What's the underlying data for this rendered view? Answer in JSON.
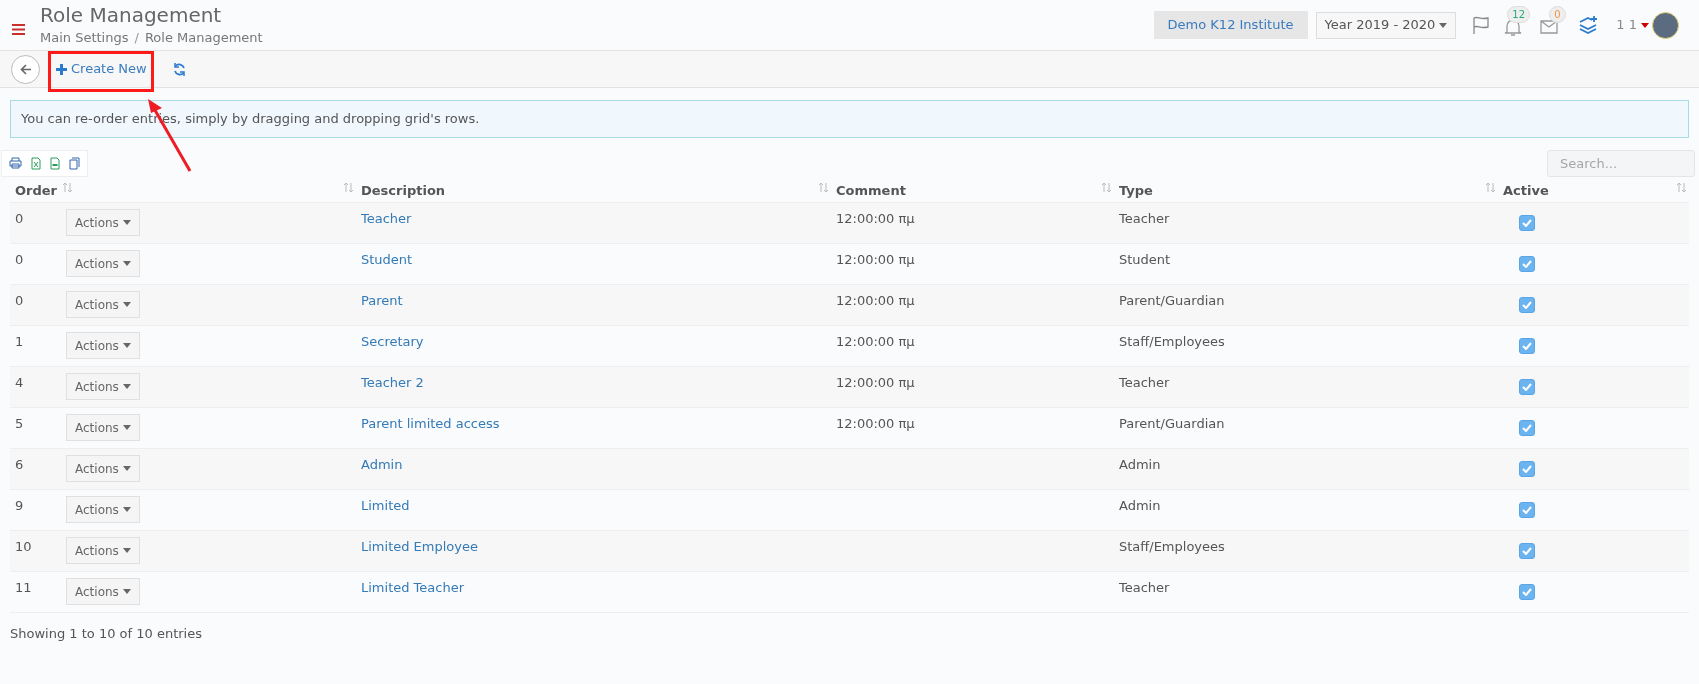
{
  "header": {
    "title": "Role Management",
    "breadcrumb": [
      "Main Settings",
      "Role Management"
    ],
    "separator": "/",
    "institute": "Demo K12 Institute",
    "year": "Year 2019 - 2020",
    "notifications": "12",
    "messages": "0",
    "user": "1 1"
  },
  "toolbar": {
    "create": "Create New"
  },
  "info": "You can re-order entries, simply by dragging and dropping grid's rows.",
  "search": {
    "placeholder": "Search..."
  },
  "table": {
    "columns": [
      "Order",
      "Description",
      "Comment",
      "Type",
      "Active"
    ],
    "rows": [
      {
        "order": "0",
        "action": "Actions",
        "description": "Teacher",
        "comment": "12:00:00 πμ",
        "type": "Teacher",
        "active": true
      },
      {
        "order": "0",
        "action": "Actions",
        "description": "Student",
        "comment": "12:00:00 πμ",
        "type": "Student",
        "active": true
      },
      {
        "order": "0",
        "action": "Actions",
        "description": "Parent",
        "comment": "12:00:00 πμ",
        "type": "Parent/Guardian",
        "active": true
      },
      {
        "order": "1",
        "action": "Actions",
        "description": "Secretary",
        "comment": "12:00:00 πμ",
        "type": "Staff/Employees",
        "active": true
      },
      {
        "order": "4",
        "action": "Actions",
        "description": "Teacher 2",
        "comment": "12:00:00 πμ",
        "type": "Teacher",
        "active": true
      },
      {
        "order": "5",
        "action": "Actions",
        "description": "Parent limited access",
        "comment": "12:00:00 πμ",
        "type": "Parent/Guardian",
        "active": true
      },
      {
        "order": "6",
        "action": "Actions",
        "description": "Admin",
        "type": "Admin",
        "active": true
      },
      {
        "order": "9",
        "action": "Actions",
        "description": "Limited",
        "type": "Admin",
        "active": true
      },
      {
        "order": "10",
        "action": "Actions",
        "description": "Limited Employee",
        "type": "Staff/Employees",
        "active": true
      },
      {
        "order": "11",
        "action": "Actions",
        "description": "Limited Teacher",
        "type": "Teacher",
        "active": true
      }
    ]
  },
  "footer": "Showing 1 to 10 of 10 entries"
}
